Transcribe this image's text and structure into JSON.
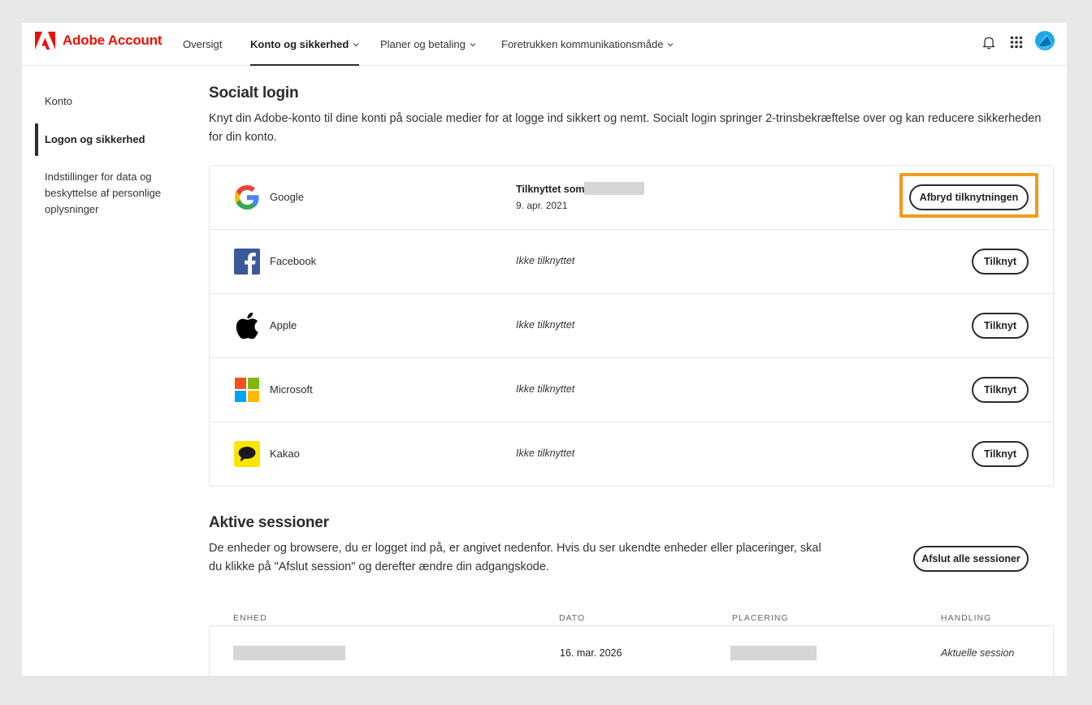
{
  "header": {
    "brand": "Adobe Account",
    "nav": [
      {
        "label": "Oversigt",
        "has_menu": false,
        "active": false
      },
      {
        "label": "Konto og sikkerhed",
        "has_menu": true,
        "active": true
      },
      {
        "label": "Planer og betaling",
        "has_menu": true,
        "active": false
      },
      {
        "label": "Foretrukken kommunikationsmåde",
        "has_menu": true,
        "active": false
      }
    ],
    "icons": [
      "bell-icon",
      "apps-grid-icon",
      "avatar"
    ]
  },
  "sidebar": {
    "items": [
      {
        "label": "Konto",
        "active": false
      },
      {
        "label": "Logon og sikkerhed",
        "active": true
      },
      {
        "label": "Indstillinger for data og beskyttelse af personlige oplysninger",
        "active": false
      }
    ]
  },
  "social": {
    "title": "Socialt login",
    "description": "Knyt din Adobe-konto til dine konti på sociale medier for at logge ind sikkert og nemt. Socialt login springer 2-trinsbekræftelse over og kan reducere sikkerheden for din konto.",
    "providers": [
      {
        "name": "Google",
        "icon": "google-icon",
        "connected": true,
        "status": "Tilknyttet som",
        "date": "9. apr. 2021",
        "action": "Afbryd tilknytningen"
      },
      {
        "name": "Facebook",
        "icon": "facebook-icon",
        "connected": false,
        "status": "Ikke tilknyttet",
        "action": "Tilknyt"
      },
      {
        "name": "Apple",
        "icon": "apple-icon",
        "connected": false,
        "status": "Ikke tilknyttet",
        "action": "Tilknyt"
      },
      {
        "name": "Microsoft",
        "icon": "microsoft-icon",
        "connected": false,
        "status": "Ikke tilknyttet",
        "action": "Tilknyt"
      },
      {
        "name": "Kakao",
        "icon": "kakao-icon",
        "connected": false,
        "status": "Ikke tilknyttet",
        "action": "Tilknyt"
      }
    ]
  },
  "sessions": {
    "title": "Aktive sessioner",
    "description": "De enheder og browsere, du er logget ind på, er angivet nedenfor. Hvis du ser ukendte enheder eller placeringer, skal du klikke på \"Afslut session\" og derefter ændre din adgangskode.",
    "end_all_label": "Afslut alle sessioner",
    "columns": [
      "ENHED",
      "DATO",
      "PLACERING",
      "HANDLING"
    ],
    "rows": [
      {
        "date": "16. mar. 2026",
        "action": "Aktuelle session"
      }
    ]
  },
  "colors": {
    "brand": "#eb1000",
    "highlight": "#f29a1c",
    "border": "#e5e5e5",
    "page_bg": "#e8e8e8"
  }
}
